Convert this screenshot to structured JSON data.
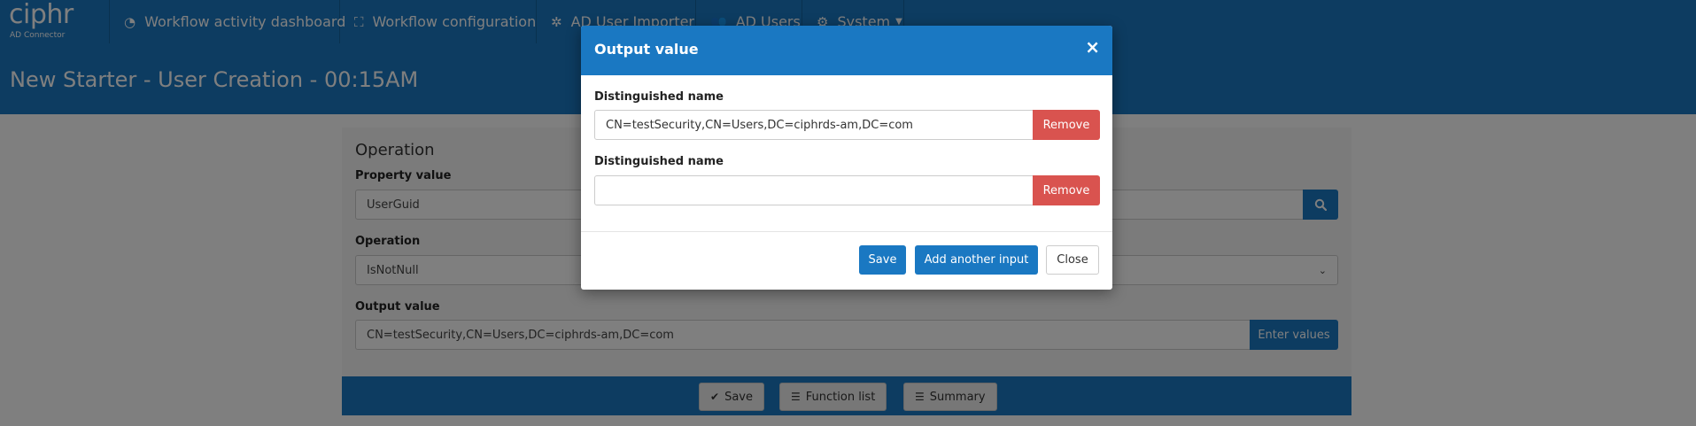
{
  "brand": {
    "name": "ciphr",
    "subtitle": "AD Connector"
  },
  "nav": {
    "items": [
      {
        "label": "Workflow activity dashboard",
        "icon": "dashboard-icon"
      },
      {
        "label": "Workflow configuration",
        "icon": "sitemap-icon"
      },
      {
        "label": "AD User Importer",
        "icon": "import-icon"
      },
      {
        "label": "AD Users",
        "icon": "users-icon"
      },
      {
        "label": "System",
        "icon": "gear-icon"
      }
    ]
  },
  "page": {
    "title": "New Starter - User Creation - 00:15AM"
  },
  "panel": {
    "title": "Operation",
    "property_label": "Property value",
    "property_value": "UserGuid",
    "operation_label": "Operation",
    "operation_value": "IsNotNull",
    "output_label": "Output value",
    "output_value": "CN=testSecurity,CN=Users,DC=ciphrds-am,DC=com",
    "enter_values_label": "Enter values",
    "footer": {
      "save_label": "Save",
      "function_list_label": "Function list",
      "summary_label": "Summary"
    }
  },
  "modal": {
    "title": "Output value",
    "close_glyph": "×",
    "inputs": [
      {
        "label": "Distinguished name",
        "value": "CN=testSecurity,CN=Users,DC=ciphrds-am,DC=com",
        "remove_label": "Remove"
      },
      {
        "label": "Distinguished name",
        "value": "",
        "remove_label": "Remove"
      }
    ],
    "save_label": "Save",
    "add_label": "Add another input",
    "close_label": "Close"
  },
  "colors": {
    "primary": "#1a78c2",
    "danger": "#d9534f"
  }
}
